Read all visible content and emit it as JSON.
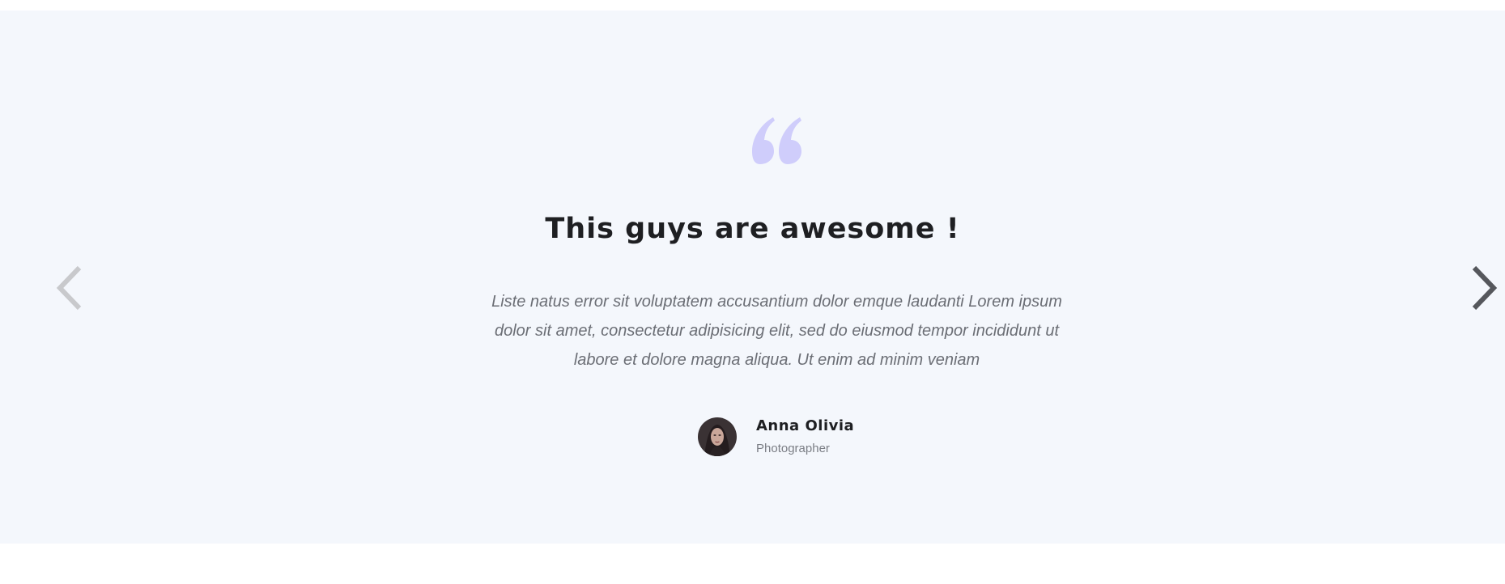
{
  "testimonial": {
    "title": "This guys are awesome !",
    "text": "Liste natus error sit voluptatem accusantium dolor emque laudanti Lorem ipsum dolor sit amet, consectetur adipisicing elit, sed do eiusmod tempor incididunt ut labore et dolore magna aliqua. Ut enim ad minim veniam",
    "author": {
      "name": "Anna Olivia",
      "role": "Photographer"
    }
  },
  "icons": {
    "quote": "quote-icon",
    "prev": "chevron-left-icon",
    "next": "chevron-right-icon"
  },
  "colors": {
    "section_background": "#f4f7fc",
    "quote_accent": "#cfcdfb",
    "prev_arrow": "#c8c9cc",
    "next_arrow": "#55575c",
    "title": "#1e1f22",
    "body_text": "#6b6e75"
  }
}
